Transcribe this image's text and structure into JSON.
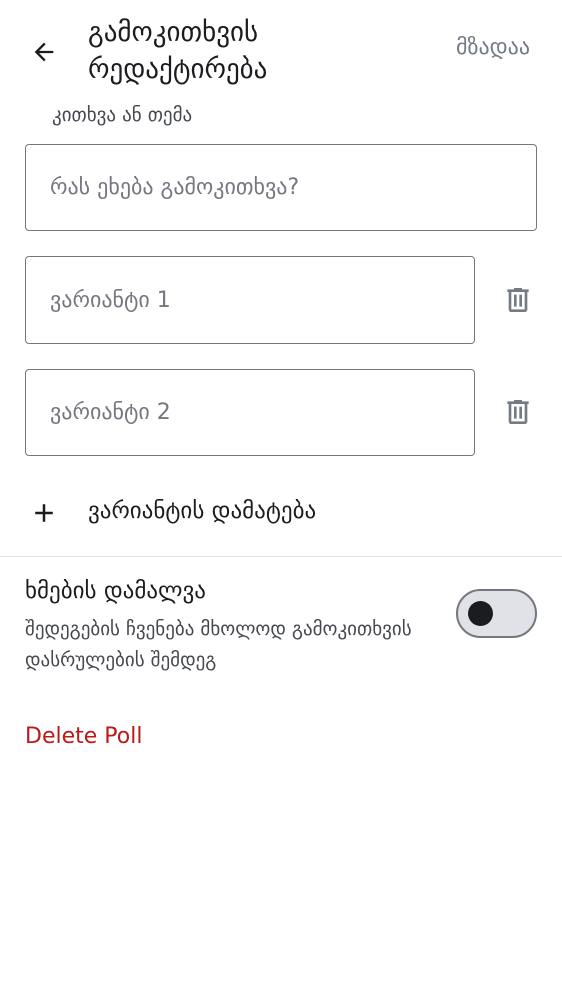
{
  "header": {
    "back_icon": "arrow-back-icon",
    "title": "გამოკითხვის რედაქტირება",
    "done_label": "მზადაა"
  },
  "question": {
    "label": "კითხვა ან თემა",
    "placeholder": "რას ეხება გამოკითხვა?"
  },
  "options": [
    {
      "placeholder": "ვარიანტი 1",
      "delete_icon": "trash-icon"
    },
    {
      "placeholder": "ვარიანტი 2",
      "delete_icon": "trash-icon"
    }
  ],
  "add_option": {
    "icon": "plus-icon",
    "label": "ვარიანტის დამატება"
  },
  "hide_votes": {
    "title": "ხმების დამალვა",
    "description": "შედეგების ჩვენება მხოლოდ გამოკითხვის დასრულების შემდეგ",
    "enabled": false
  },
  "delete_label": "Delete Poll",
  "colors": {
    "text": "#1b1c1f",
    "secondary_text": "#44474e",
    "outline": "#74777f",
    "danger": "#ba1a1a"
  }
}
